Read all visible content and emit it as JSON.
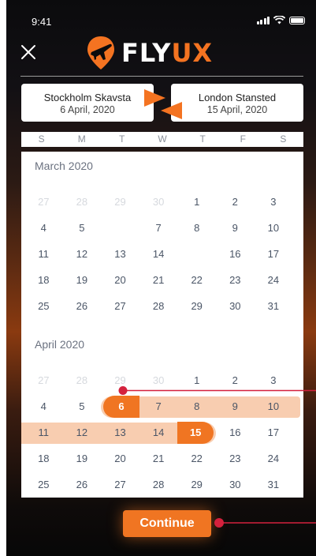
{
  "status": {
    "time": "9:41"
  },
  "brand": {
    "fly": "FLY",
    "ux": "UX",
    "accent": "#f47321"
  },
  "route": {
    "from": {
      "city": "Stockholm Skavsta",
      "date": "6 April, 2020"
    },
    "to": {
      "city": "London Stansted",
      "date": "15 April, 2020"
    }
  },
  "weekdays": [
    "S",
    "M",
    "T",
    "W",
    "T",
    "F",
    "S"
  ],
  "months": [
    {
      "title": "March 2020",
      "weeks": [
        [
          {
            "d": "27",
            "dim": true
          },
          {
            "d": "28",
            "dim": true
          },
          {
            "d": "29",
            "dim": true
          },
          {
            "d": "30",
            "dim": true
          },
          {
            "d": "1"
          },
          {
            "d": "2"
          },
          {
            "d": "3"
          }
        ],
        [
          {
            "d": "4"
          },
          {
            "d": "5"
          },
          {
            "d": ""
          },
          {
            "d": "7"
          },
          {
            "d": "8"
          },
          {
            "d": "9"
          },
          {
            "d": "10"
          }
        ],
        [
          {
            "d": "11"
          },
          {
            "d": "12"
          },
          {
            "d": "13"
          },
          {
            "d": "14"
          },
          {
            "d": ""
          },
          {
            "d": "16"
          },
          {
            "d": "17"
          }
        ],
        [
          {
            "d": "18"
          },
          {
            "d": "19"
          },
          {
            "d": "20"
          },
          {
            "d": "21"
          },
          {
            "d": "22"
          },
          {
            "d": "23"
          },
          {
            "d": "24"
          }
        ],
        [
          {
            "d": "25"
          },
          {
            "d": "26"
          },
          {
            "d": "27"
          },
          {
            "d": "28"
          },
          {
            "d": "29"
          },
          {
            "d": "30"
          },
          {
            "d": "31"
          }
        ]
      ]
    },
    {
      "title": "April 2020",
      "weeks": [
        [
          {
            "d": "27",
            "dim": true
          },
          {
            "d": "28",
            "dim": true
          },
          {
            "d": "29",
            "dim": true
          },
          {
            "d": "30",
            "dim": true
          },
          {
            "d": "1"
          },
          {
            "d": "2"
          },
          {
            "d": "3"
          }
        ],
        [
          {
            "d": "4"
          },
          {
            "d": "5"
          },
          {
            "d": "6",
            "start": true
          },
          {
            "d": "7",
            "range": true
          },
          {
            "d": "8",
            "range": true
          },
          {
            "d": "9",
            "range": true
          },
          {
            "d": "10",
            "range": true
          }
        ],
        [
          {
            "d": "11",
            "range": true
          },
          {
            "d": "12",
            "range": true
          },
          {
            "d": "13",
            "range": true
          },
          {
            "d": "14",
            "range": true
          },
          {
            "d": "15",
            "end": true
          },
          {
            "d": "16"
          },
          {
            "d": "17"
          }
        ],
        [
          {
            "d": "18"
          },
          {
            "d": "19"
          },
          {
            "d": "20"
          },
          {
            "d": "21"
          },
          {
            "d": "22"
          },
          {
            "d": "23"
          },
          {
            "d": "24"
          }
        ],
        [
          {
            "d": "25"
          },
          {
            "d": "26"
          },
          {
            "d": "27"
          },
          {
            "d": "28"
          },
          {
            "d": "29"
          },
          {
            "d": "30"
          },
          {
            "d": "31"
          }
        ]
      ]
    }
  ],
  "actions": {
    "continue": "Continue"
  },
  "colors": {
    "accent": "#f07522",
    "range": "#f8cdb0",
    "marker": "#d4213d"
  }
}
